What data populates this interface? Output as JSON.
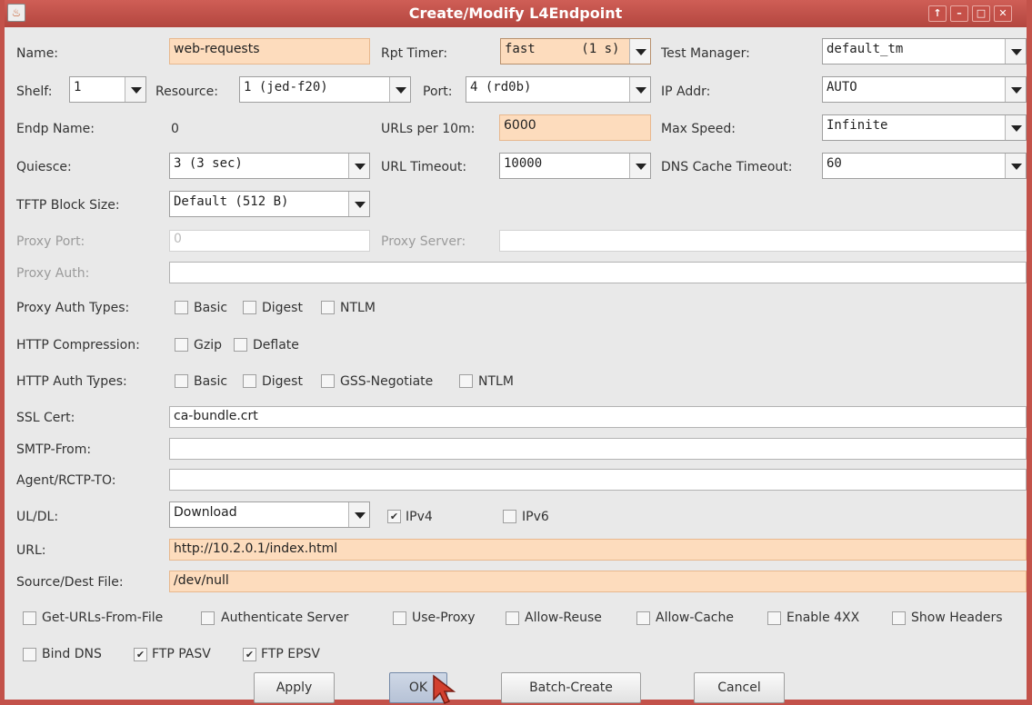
{
  "window": {
    "title": "Create/Modify L4Endpoint",
    "controls": [
      "↑",
      "–",
      "□",
      "✕"
    ]
  },
  "row1": {
    "name_label": "Name:",
    "name_value": "web-requests",
    "rpt_timer_label": "Rpt Timer:",
    "rpt_timer_value": "fast      (1 s)",
    "test_manager_label": "Test Manager:",
    "test_manager_value": "default_tm"
  },
  "row2": {
    "shelf_label": "Shelf:",
    "shelf_value": "1",
    "resource_label": "Resource:",
    "resource_value": "1 (jed-f20)",
    "port_label": "Port:",
    "port_value": "4 (rd0b)",
    "ip_addr_label": "IP Addr:",
    "ip_addr_value": "AUTO"
  },
  "row3": {
    "endp_name_label": "Endp Name:",
    "endp_name_value": "0",
    "urls_label": "URLs per 10m:",
    "urls_value": "6000",
    "max_speed_label": "Max Speed:",
    "max_speed_value": "Infinite"
  },
  "row4": {
    "quiesce_label": "Quiesce:",
    "quiesce_value": "3 (3 sec)",
    "url_timeout_label": "URL Timeout:",
    "url_timeout_value": "10000",
    "dns_label": "DNS Cache Timeout:",
    "dns_value": "60"
  },
  "row5": {
    "tftp_label": "TFTP Block Size:",
    "tftp_value": "Default (512 B)"
  },
  "proxy": {
    "port_label": "Proxy Port:",
    "port_value": "0",
    "server_label": "Proxy Server:",
    "server_value": "",
    "auth_label": "Proxy Auth:",
    "auth_value": ""
  },
  "proxy_auth_types": {
    "label": "Proxy Auth Types:",
    "options": [
      {
        "label": "Basic",
        "mark": ""
      },
      {
        "label": "Digest",
        "mark": ""
      },
      {
        "label": "NTLM",
        "mark": ""
      }
    ]
  },
  "http_compression": {
    "label": "HTTP Compression:",
    "options": [
      {
        "label": "Gzip",
        "mark": ""
      },
      {
        "label": "Deflate",
        "mark": ""
      }
    ]
  },
  "http_auth_types": {
    "label": "HTTP Auth Types:",
    "options": [
      {
        "label": "Basic",
        "mark": ""
      },
      {
        "label": "Digest",
        "mark": ""
      },
      {
        "label": "GSS-Negotiate",
        "mark": ""
      },
      {
        "label": "NTLM",
        "mark": ""
      }
    ]
  },
  "ssl_cert": {
    "label": "SSL Cert:",
    "value": "ca-bundle.crt"
  },
  "smtp_from": {
    "label": "SMTP-From:",
    "value": ""
  },
  "agent_rctp_to": {
    "label": "Agent/RCTP-TO:",
    "value": ""
  },
  "uldl": {
    "label": "UL/DL:",
    "value": "Download",
    "ipv4_label": "IPv4",
    "ipv4_mark": "✔",
    "ipv6_label": "IPv6",
    "ipv6_mark": ""
  },
  "url": {
    "label": "URL:",
    "value": "http://10.2.0.1/index.html"
  },
  "source_dest": {
    "label": "Source/Dest File:",
    "value": "/dev/null"
  },
  "flags": [
    {
      "label": "Get-URLs-From-File",
      "mark": ""
    },
    {
      "label": "Authenticate Server",
      "mark": ""
    },
    {
      "label": "Use-Proxy",
      "mark": ""
    },
    {
      "label": "Allow-Reuse",
      "mark": ""
    },
    {
      "label": "Allow-Cache",
      "mark": ""
    },
    {
      "label": "Enable 4XX",
      "mark": ""
    },
    {
      "label": "Show Headers",
      "mark": ""
    }
  ],
  "flags2": [
    {
      "label": "Bind DNS",
      "mark": ""
    },
    {
      "label": "FTP PASV",
      "mark": "✔"
    },
    {
      "label": "FTP EPSV",
      "mark": "✔"
    }
  ],
  "buttons": {
    "apply": "Apply",
    "ok": "OK",
    "batch_create": "Batch-Create",
    "cancel": "Cancel"
  },
  "colors": {
    "titlebar": "#c3524a",
    "edited_field": "#fddcbd",
    "window_bg": "#e9e9e9"
  },
  "app_icon_glyph": "♨"
}
